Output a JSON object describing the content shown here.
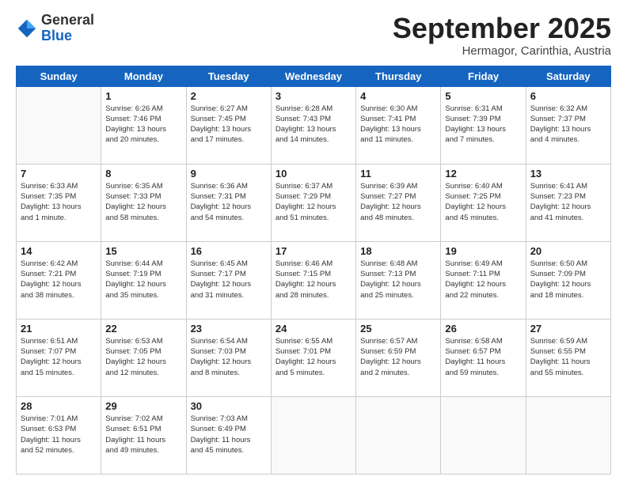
{
  "header": {
    "logo_general": "General",
    "logo_blue": "Blue",
    "month_title": "September 2025",
    "location": "Hermagor, Carinthia, Austria"
  },
  "weekdays": [
    "Sunday",
    "Monday",
    "Tuesday",
    "Wednesday",
    "Thursday",
    "Friday",
    "Saturday"
  ],
  "weeks": [
    [
      {
        "day": "",
        "info": ""
      },
      {
        "day": "1",
        "info": "Sunrise: 6:26 AM\nSunset: 7:46 PM\nDaylight: 13 hours\nand 20 minutes."
      },
      {
        "day": "2",
        "info": "Sunrise: 6:27 AM\nSunset: 7:45 PM\nDaylight: 13 hours\nand 17 minutes."
      },
      {
        "day": "3",
        "info": "Sunrise: 6:28 AM\nSunset: 7:43 PM\nDaylight: 13 hours\nand 14 minutes."
      },
      {
        "day": "4",
        "info": "Sunrise: 6:30 AM\nSunset: 7:41 PM\nDaylight: 13 hours\nand 11 minutes."
      },
      {
        "day": "5",
        "info": "Sunrise: 6:31 AM\nSunset: 7:39 PM\nDaylight: 13 hours\nand 7 minutes."
      },
      {
        "day": "6",
        "info": "Sunrise: 6:32 AM\nSunset: 7:37 PM\nDaylight: 13 hours\nand 4 minutes."
      }
    ],
    [
      {
        "day": "7",
        "info": "Sunrise: 6:33 AM\nSunset: 7:35 PM\nDaylight: 13 hours\nand 1 minute."
      },
      {
        "day": "8",
        "info": "Sunrise: 6:35 AM\nSunset: 7:33 PM\nDaylight: 12 hours\nand 58 minutes."
      },
      {
        "day": "9",
        "info": "Sunrise: 6:36 AM\nSunset: 7:31 PM\nDaylight: 12 hours\nand 54 minutes."
      },
      {
        "day": "10",
        "info": "Sunrise: 6:37 AM\nSunset: 7:29 PM\nDaylight: 12 hours\nand 51 minutes."
      },
      {
        "day": "11",
        "info": "Sunrise: 6:39 AM\nSunset: 7:27 PM\nDaylight: 12 hours\nand 48 minutes."
      },
      {
        "day": "12",
        "info": "Sunrise: 6:40 AM\nSunset: 7:25 PM\nDaylight: 12 hours\nand 45 minutes."
      },
      {
        "day": "13",
        "info": "Sunrise: 6:41 AM\nSunset: 7:23 PM\nDaylight: 12 hours\nand 41 minutes."
      }
    ],
    [
      {
        "day": "14",
        "info": "Sunrise: 6:42 AM\nSunset: 7:21 PM\nDaylight: 12 hours\nand 38 minutes."
      },
      {
        "day": "15",
        "info": "Sunrise: 6:44 AM\nSunset: 7:19 PM\nDaylight: 12 hours\nand 35 minutes."
      },
      {
        "day": "16",
        "info": "Sunrise: 6:45 AM\nSunset: 7:17 PM\nDaylight: 12 hours\nand 31 minutes."
      },
      {
        "day": "17",
        "info": "Sunrise: 6:46 AM\nSunset: 7:15 PM\nDaylight: 12 hours\nand 28 minutes."
      },
      {
        "day": "18",
        "info": "Sunrise: 6:48 AM\nSunset: 7:13 PM\nDaylight: 12 hours\nand 25 minutes."
      },
      {
        "day": "19",
        "info": "Sunrise: 6:49 AM\nSunset: 7:11 PM\nDaylight: 12 hours\nand 22 minutes."
      },
      {
        "day": "20",
        "info": "Sunrise: 6:50 AM\nSunset: 7:09 PM\nDaylight: 12 hours\nand 18 minutes."
      }
    ],
    [
      {
        "day": "21",
        "info": "Sunrise: 6:51 AM\nSunset: 7:07 PM\nDaylight: 12 hours\nand 15 minutes."
      },
      {
        "day": "22",
        "info": "Sunrise: 6:53 AM\nSunset: 7:05 PM\nDaylight: 12 hours\nand 12 minutes."
      },
      {
        "day": "23",
        "info": "Sunrise: 6:54 AM\nSunset: 7:03 PM\nDaylight: 12 hours\nand 8 minutes."
      },
      {
        "day": "24",
        "info": "Sunrise: 6:55 AM\nSunset: 7:01 PM\nDaylight: 12 hours\nand 5 minutes."
      },
      {
        "day": "25",
        "info": "Sunrise: 6:57 AM\nSunset: 6:59 PM\nDaylight: 12 hours\nand 2 minutes."
      },
      {
        "day": "26",
        "info": "Sunrise: 6:58 AM\nSunset: 6:57 PM\nDaylight: 11 hours\nand 59 minutes."
      },
      {
        "day": "27",
        "info": "Sunrise: 6:59 AM\nSunset: 6:55 PM\nDaylight: 11 hours\nand 55 minutes."
      }
    ],
    [
      {
        "day": "28",
        "info": "Sunrise: 7:01 AM\nSunset: 6:53 PM\nDaylight: 11 hours\nand 52 minutes."
      },
      {
        "day": "29",
        "info": "Sunrise: 7:02 AM\nSunset: 6:51 PM\nDaylight: 11 hours\nand 49 minutes."
      },
      {
        "day": "30",
        "info": "Sunrise: 7:03 AM\nSunset: 6:49 PM\nDaylight: 11 hours\nand 45 minutes."
      },
      {
        "day": "",
        "info": ""
      },
      {
        "day": "",
        "info": ""
      },
      {
        "day": "",
        "info": ""
      },
      {
        "day": "",
        "info": ""
      }
    ]
  ]
}
